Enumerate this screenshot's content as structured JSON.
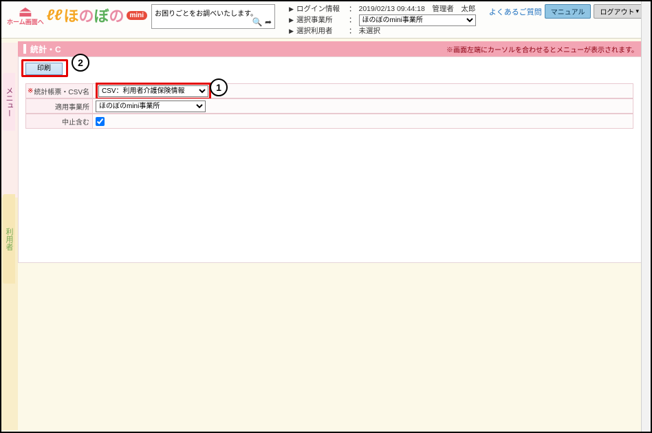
{
  "header": {
    "home_label": "ホーム画面へ",
    "logo": {
      "l": "ℓℓ",
      "ho": "ほ",
      "no": "の",
      "bo": "ぼ",
      "no2": "の",
      "mini": "mini"
    },
    "trouble_text": "お困りごとをお調べいたします。",
    "info": [
      {
        "label": "ログイン情報",
        "value": "2019/02/13 09:44:18　管理者　太郎"
      },
      {
        "label": "選択事業所",
        "select": "ほのぼのmini事業所"
      },
      {
        "label": "選択利用者",
        "value": "未選択"
      }
    ],
    "faq": "よくあるご質問",
    "manual": "マニュアル",
    "logout": "ログアウト"
  },
  "section": {
    "title": "統計・C",
    "hint": "※画面左端にカーソルを合わせるとメニューが表示されます。"
  },
  "toolbar": {
    "print": "印刷"
  },
  "form": {
    "csv_label": "統計帳票・CSV名",
    "csv_value": "CSV：利用者介護保険情報",
    "office_label": "適用事業所",
    "office_value": "ほのぼのmini事業所",
    "discont_label": "中止含む",
    "discont_checked": true
  },
  "callouts": {
    "one": "1",
    "two": "2"
  },
  "side_tabs": {
    "menu": "メニュー",
    "user": "利用者"
  }
}
